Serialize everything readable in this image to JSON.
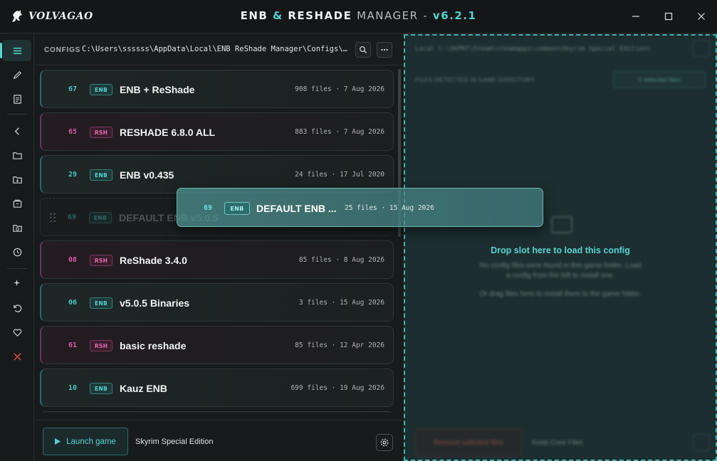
{
  "window": {
    "brand": "VOLVAGAO",
    "title_enb": "ENB",
    "title_amp": "&",
    "title_reshade": "RESHADE",
    "title_manager": "MANAGER",
    "title_sep": "-",
    "version": "v6.2.1",
    "controls": [
      "minimize-icon",
      "maximize-icon",
      "close-icon"
    ]
  },
  "rail": {
    "items": [
      {
        "icon": "list-icon",
        "active": true
      },
      {
        "icon": "pencil-icon",
        "active": false
      },
      {
        "icon": "document-icon",
        "active": false
      },
      {
        "icon": "chevron-left-icon",
        "active": false
      },
      {
        "icon": "folder-icon",
        "active": false
      },
      {
        "icon": "folder-download-icon",
        "active": false
      },
      {
        "icon": "archive-icon",
        "active": false
      },
      {
        "icon": "folder-open-icon",
        "active": false
      },
      {
        "icon": "clock-icon",
        "active": false
      },
      {
        "icon": "sparkle-icon",
        "active": false
      },
      {
        "icon": "undo-icon",
        "active": false
      },
      {
        "icon": "heart-icon",
        "active": false
      },
      {
        "icon": "close-red-icon",
        "active": false
      }
    ]
  },
  "configs": {
    "label": "CONFIGS",
    "path": "C:\\Users\\ssssss\\AppData\\Local\\ENB ReShade Manager\\Configs\\Skyrim Special Edition",
    "rows": [
      {
        "num": "67",
        "type": "ENB",
        "name": "ENB + ReShade",
        "meta": "908 files · 7 Aug 2026"
      },
      {
        "num": "65",
        "type": "RSH",
        "name": "RESHADE 6.8.0 ALL",
        "meta": "883 files · 7 Aug 2026"
      },
      {
        "num": "29",
        "type": "ENB",
        "name": "ENB v0.435",
        "meta": "24 files · 17 Jul 2020"
      },
      {
        "num": "69",
        "type": "ENB",
        "name": "DEFAULT ENB v5.0.5",
        "meta": "",
        "ghost": true
      },
      {
        "num": "08",
        "type": "RSH",
        "name": "ReShade 3.4.0",
        "meta": "85 files · 8 Aug 2026"
      },
      {
        "num": "06",
        "type": "ENB",
        "name": "v5.0.5 Binaries",
        "meta": "3 files · 15 Aug 2026"
      },
      {
        "num": "61",
        "type": "RSH",
        "name": "basic reshade",
        "meta": "85 files · 12 Apr 2026"
      },
      {
        "num": "10",
        "type": "ENB",
        "name": "Kauz ENB",
        "meta": "699 files · 19 Aug 2026"
      }
    ]
  },
  "drag": {
    "num": "69",
    "type": "ENB",
    "name": "DEFAULT ENB ...",
    "meta": "25 files · 15 Aug 2026"
  },
  "footer": {
    "launch_label": "Launch game",
    "game": "Skyrim Special Edition"
  },
  "right": {
    "local_path": "Local  C:\\SKPRT\\Steam\\steamapps\\common\\Skyrim Special Edition\\",
    "files_label": "FILES DETECTED IN GAME DIRECTORY",
    "detected_btn": "0 selected files",
    "drop_title": "Drop slot here to load this config",
    "empty_line1": "No config files were found in this game folder. Load",
    "empty_line2": "a config from the left to install one.",
    "empty_line3": "Or drag files here to install them to the game folder.",
    "remove_btn": "Remove selected files",
    "keep_core": "Keep Core Files"
  }
}
